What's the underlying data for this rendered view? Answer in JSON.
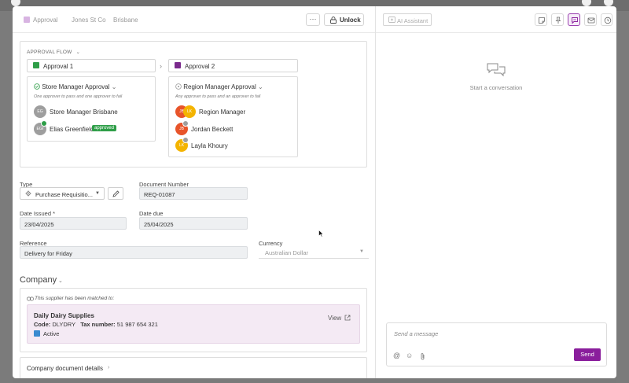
{
  "breadcrumb": {
    "item1": "Approval",
    "item2": "Jones St Co",
    "item3": "Brisbane"
  },
  "toolbar": {
    "more_label": "···",
    "unlock_label": "Unlock"
  },
  "approval_flow": {
    "title": "APPROVAL FLOW",
    "stage1": {
      "label": "Approval 1",
      "color": "#2e9e48"
    },
    "stage2": {
      "label": "Approval 2",
      "color": "#7a2a8c"
    },
    "card1": {
      "title": "Store Manager Approval",
      "rule": "One approver to pass and one approver to fail",
      "member1": {
        "initials": "EG",
        "name": "Store Manager Brisbane"
      },
      "member2": {
        "initials": "EGr",
        "name": "Elias Greenfield",
        "status": "approved"
      }
    },
    "card2": {
      "title": "Region Manager Approval",
      "rule": "Any approver to pass and an approver to fail",
      "member1": {
        "initials": "JB",
        "initials2": "LK",
        "name": "Region Manager"
      },
      "member2": {
        "initials": "JB",
        "name": "Jordan Beckett"
      },
      "member3": {
        "initials": "LK",
        "name": "Layla Khoury"
      }
    }
  },
  "form": {
    "type_label": "Type",
    "type_value": "Purchase Requisitio...",
    "doc_number_label": "Document Number",
    "doc_number_value": "REQ-01087",
    "date_issued_label": "Date Issued *",
    "date_issued_value": "23/04/2025",
    "date_due_label": "Date due",
    "date_due_value": "25/04/2025",
    "reference_label": "Reference",
    "reference_value": "Delivery for Friday",
    "currency_label": "Currency",
    "currency_value": "Australian Dollar"
  },
  "company": {
    "section_title": "Company",
    "matched_note": "This supplier has been matched to:",
    "supplier_name": "Daily Dairy Supplies",
    "code_label": "Code:",
    "code_value": "DLYDRY",
    "tax_label": "Tax number:",
    "tax_value": "51 987 654 321",
    "status": "Active",
    "status_color": "#3a8bd0",
    "view_label": "View",
    "details_label": "Company document details"
  },
  "chat": {
    "ai_button": "AI Assistant",
    "empty_text": "Start a conversation",
    "placeholder": "Send a message",
    "send_label": "Send"
  }
}
